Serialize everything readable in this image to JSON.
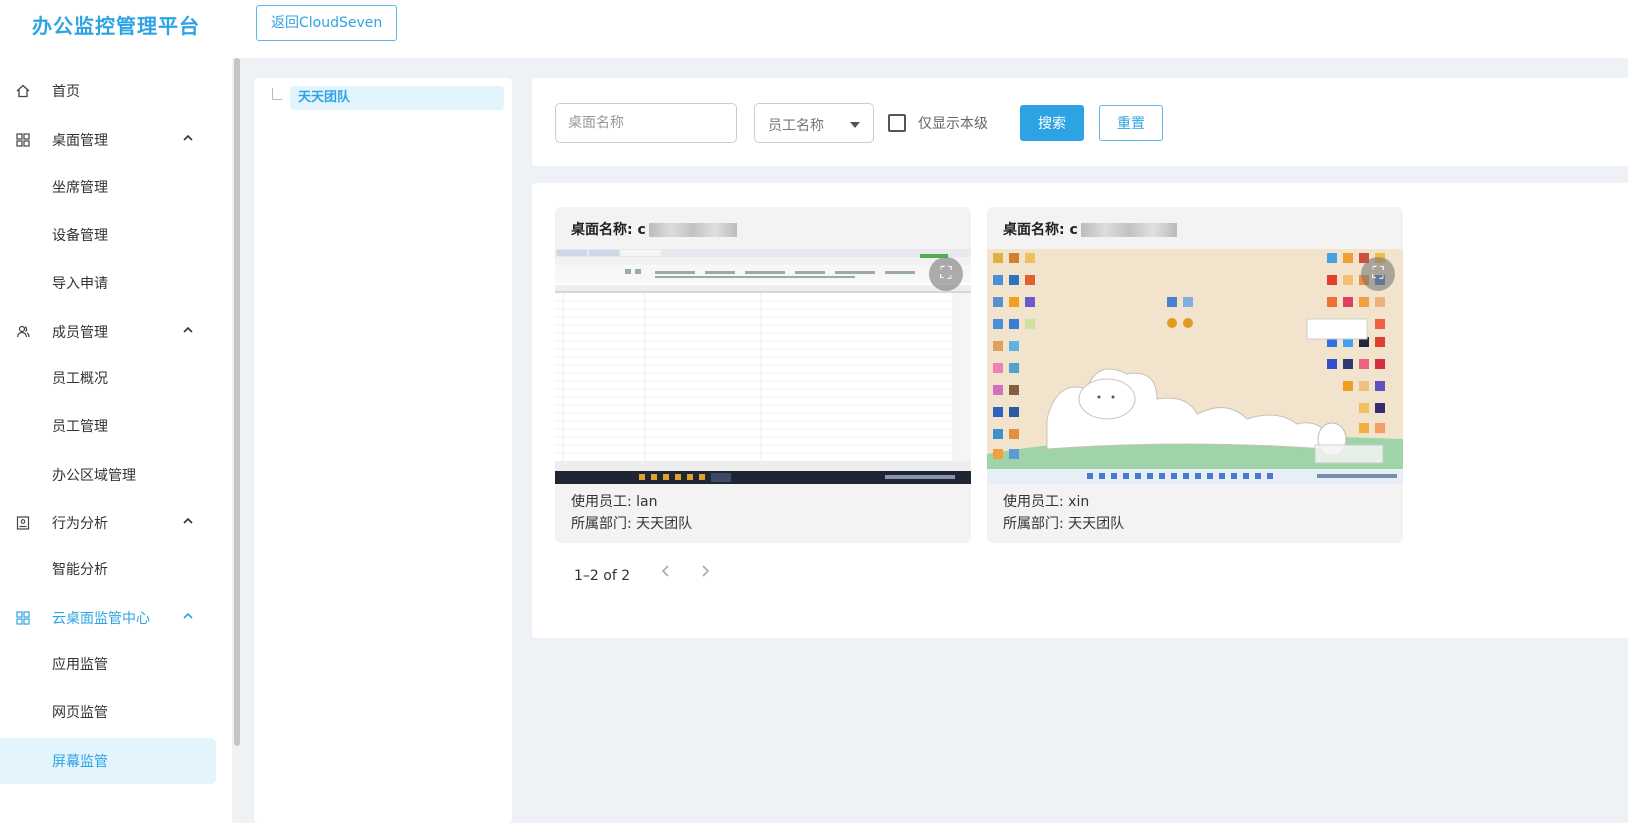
{
  "header": {
    "title": "办公监控管理平台",
    "back_button": "返回CloudSeven"
  },
  "sidebar": {
    "items": [
      {
        "label": "首页",
        "icon": "home-icon",
        "type": "item"
      },
      {
        "label": "桌面管理",
        "icon": "desktop-grid-icon",
        "type": "group",
        "expanded": true
      },
      {
        "label": "坐席管理",
        "type": "sub"
      },
      {
        "label": "设备管理",
        "type": "sub"
      },
      {
        "label": "导入申请",
        "type": "sub"
      },
      {
        "label": "成员管理",
        "icon": "users-icon",
        "type": "group",
        "expanded": true
      },
      {
        "label": "员工概况",
        "type": "sub"
      },
      {
        "label": "员工管理",
        "type": "sub"
      },
      {
        "label": "办公区域管理",
        "type": "sub"
      },
      {
        "label": "行为分析",
        "icon": "monitor-icon",
        "type": "group",
        "expanded": true
      },
      {
        "label": "智能分析",
        "type": "sub"
      },
      {
        "label": "云桌面监管中心",
        "icon": "cloud-grid-icon",
        "type": "group",
        "expanded": true,
        "active": true
      },
      {
        "label": "应用监管",
        "type": "sub"
      },
      {
        "label": "网页监管",
        "type": "sub"
      },
      {
        "label": "屏幕监管",
        "type": "sub",
        "selected": true
      }
    ]
  },
  "tree": {
    "root": "天天团队"
  },
  "search": {
    "desktop_placeholder": "桌面名称",
    "desktop_value": "",
    "employee_placeholder": "员工名称",
    "only_current_level_label": "仅显示本级",
    "only_current_level_checked": false,
    "search_button": "搜索",
    "reset_button": "重置"
  },
  "results": {
    "cards": [
      {
        "title_label": "桌面名称:",
        "title_value": "c",
        "employee_label": "使用员工:",
        "employee": "lan",
        "dept_label": "所属部门:",
        "dept": "天天团队",
        "screen": "spreadsheet"
      },
      {
        "title_label": "桌面名称:",
        "title_value": "c",
        "employee_label": "使用员工:",
        "employee": "xin",
        "dept_label": "所属部门:",
        "dept": "天天团队",
        "screen": "desktop"
      }
    ],
    "pagination": {
      "summary": "1–2 of 2"
    }
  },
  "colors": {
    "accent": "#2ea3e4",
    "selected_bg": "#e3f4fd",
    "page_bg": "#eef1f6"
  }
}
